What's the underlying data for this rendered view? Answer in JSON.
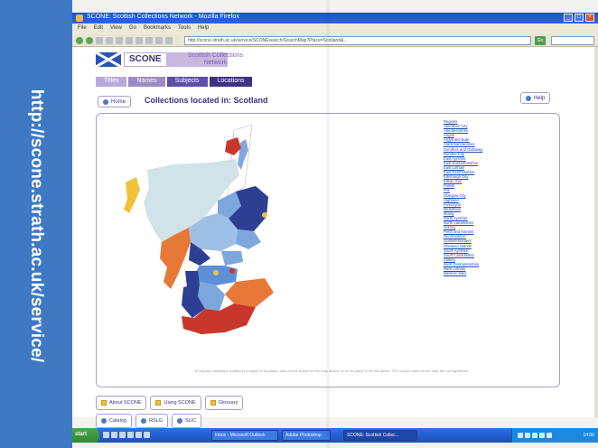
{
  "slide": {
    "url_caption": "http://scone.strath.ac.uk/service/"
  },
  "browser": {
    "window_title": "SCONE: Scottish Collections Network - Mozilla Firefox",
    "menu": [
      "File",
      "Edit",
      "View",
      "Go",
      "Bookmarks",
      "Tools",
      "Help"
    ],
    "address_label": "",
    "address_value": "http://scone.strath.ac.uk/service/SCONEsearch/SearchMap?Place=Scotland&...",
    "go_label": "Go"
  },
  "site": {
    "logo_text": "SCONE",
    "tagline_line1": "Scottish Collections",
    "tagline_line2": "Network",
    "nav": [
      "Titles",
      "Names",
      "Subjects",
      "Locations"
    ],
    "home_label": "Home",
    "help_label": "Help",
    "heading": "Collections located in: Scotland",
    "regions": [
      "Regions",
      "Aberdeen City",
      "Aberdeenshire",
      "Angus",
      "Argyll and Bute",
      "Clackmannanshire",
      "Dumfries and Galloway",
      "Dundee City",
      "East Ayrshire",
      "East Dunbartonshire",
      "East Lothian",
      "East Renfrewshire",
      "Edinburgh City",
      "Eilean Siar",
      "Falkirk",
      "Fife",
      "Glasgow City",
      "Highland",
      "Inverclyde",
      "Midlothian",
      "Moray",
      "North Ayrshire",
      "North Lanarkshire",
      "Orkney",
      "Perth and Kinross",
      "Renfrewshire",
      "Scottish Borders",
      "Shetland Islands",
      "South Ayrshire",
      "South Lanarkshire",
      "Stirling",
      "West Dunbartonshire",
      "West Lothian",
      "Western Isles"
    ],
    "map_note": "To display collections located in a region of Scotland, click on the region on the map above, or on its name in the list above. The colours used on the map are not significant.",
    "lower_buttons": [
      "About SCONE",
      "Using SCONE",
      "Glossary"
    ],
    "lower_buttons2": [
      "Catalog",
      "RSLG",
      "SLIC"
    ]
  },
  "taskbar": {
    "start_label": "start",
    "tasks": [
      "Inbox - Microsoft Outlook",
      "Adobe Photoshop",
      "SCONE: Scottish Collec..."
    ],
    "clock": "14:06"
  },
  "colors": {
    "band_blue": "#3f79c4",
    "nav_purple": "#5d4fa2",
    "link_blue": "#1f4fb6",
    "map_light": "#cfe3e8",
    "map_mid_blue": "#7ea7dd",
    "map_dark_blue": "#2d3f93",
    "map_orange": "#e87838",
    "map_red": "#c9372c",
    "map_yellow": "#f0c23b"
  }
}
